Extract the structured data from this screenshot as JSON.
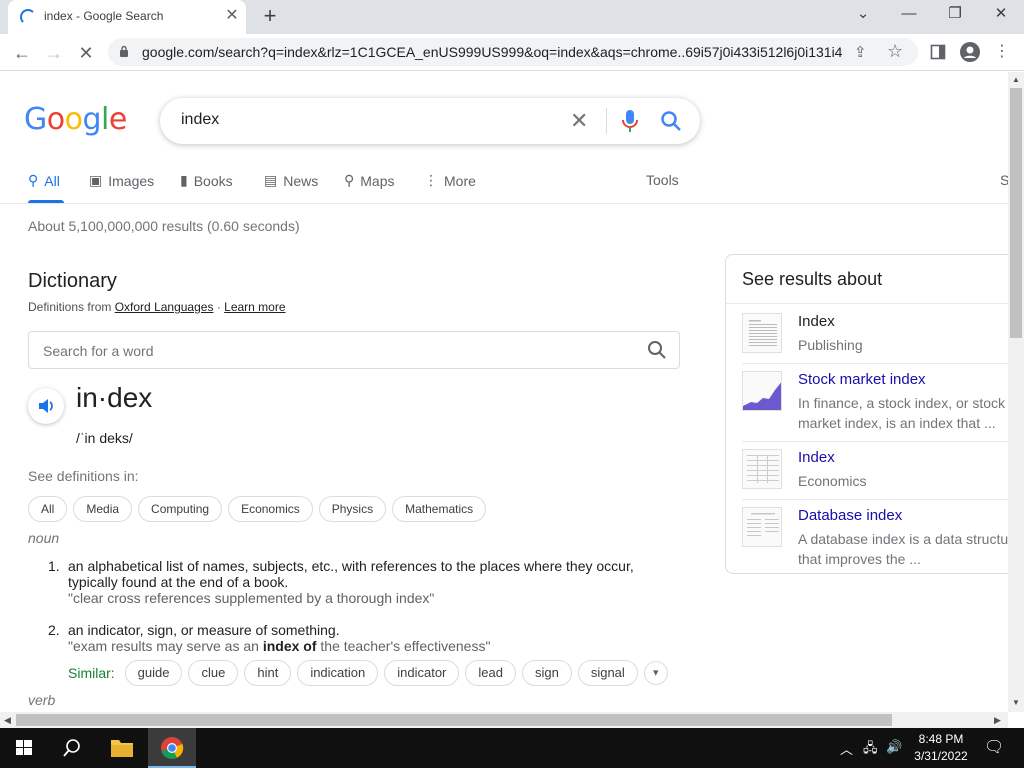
{
  "browser": {
    "tab_title": "index - Google Search",
    "url": "google.com/search?q=index&rlz=1C1GCEA_enUS999US999&oq=index&aqs=chrome..69i57j0i433i512l6j0i131i4..."
  },
  "search": {
    "logo": [
      "G",
      "o",
      "o",
      "g",
      "l",
      "e"
    ],
    "logo_colors": [
      "#4285f4",
      "#ea4335",
      "#fbbc05",
      "#4285f4",
      "#34a853",
      "#ea4335"
    ],
    "query": "index"
  },
  "tabs": [
    {
      "label": "All",
      "icon": "search-icon"
    },
    {
      "label": "Images",
      "icon": "image-icon"
    },
    {
      "label": "Books",
      "icon": "book-icon"
    },
    {
      "label": "News",
      "icon": "news-icon"
    },
    {
      "label": "Maps",
      "icon": "map-pin-icon"
    },
    {
      "label": "More",
      "icon": "more-vertical-icon"
    }
  ],
  "tools_label": "Tools",
  "right_clip": "S",
  "stats": "About 5,100,000,000 results (0.60 seconds)",
  "dictionary": {
    "title": "Dictionary",
    "source_prefix": "Definitions from",
    "source_link": "Oxford Languages",
    "separator": "·",
    "learn_more": "Learn more",
    "search_placeholder": "Search for a word",
    "headword": "in·dex",
    "phonetic": "/ˈin deks/",
    "see_definitions": "See definitions in:",
    "categories": [
      "All",
      "Media",
      "Computing",
      "Economics",
      "Physics",
      "Mathematics"
    ],
    "pos_noun": "noun",
    "definitions": [
      {
        "num": "1.",
        "text": "an alphabetical list of names, subjects, etc., with references to the places where they occur, typically found at the end of a book.",
        "example": "\"clear cross references supplemented by a thorough index\""
      },
      {
        "num": "2.",
        "text": "an indicator, sign, or measure of something.",
        "example_pre": "\"exam results may serve as an ",
        "example_bold": "index of",
        "example_post": " the teacher's effectiveness\""
      }
    ],
    "similar_label": "Similar:",
    "similar": [
      "guide",
      "clue",
      "hint",
      "indication",
      "indicator",
      "lead",
      "sign",
      "signal"
    ],
    "pos_verb": "verb"
  },
  "panel": {
    "title": "See results about",
    "items": [
      {
        "name": "Index",
        "sub": "Publishing"
      },
      {
        "name": "Stock market index",
        "sub": "In finance, a stock index, or stock market index, is an index that ..."
      },
      {
        "name": "Index",
        "sub": "Economics"
      },
      {
        "name": "Database index",
        "sub": "A database index is a data structure that improves the ..."
      }
    ]
  },
  "taskbar": {
    "time": "8:48 PM",
    "date": "3/31/2022"
  },
  "colors": {
    "accent": "#1a73e8",
    "link": "#1a0dab",
    "similar": "#188038"
  }
}
